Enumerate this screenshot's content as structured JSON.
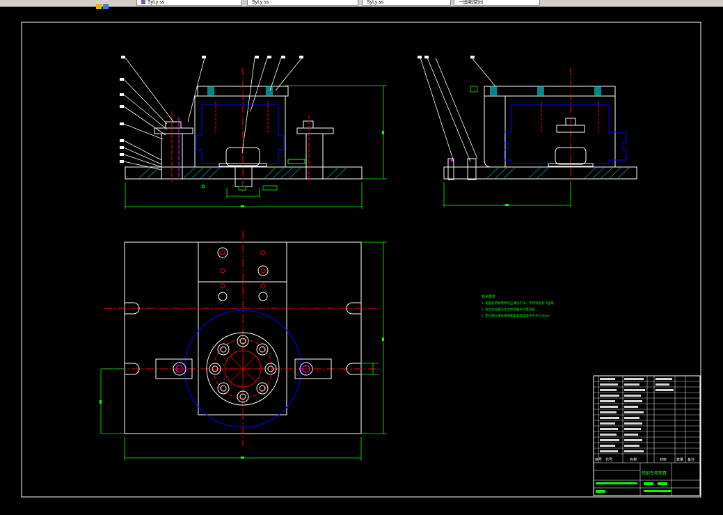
{
  "window": {
    "tabs": [
      {
        "label": "Sy̲Ly̲ ss"
      },
      {
        "label": "Sy̲Ly̲ ss"
      },
      {
        "label": "Sy̲Ly̲ ss"
      },
      {
        "label": "一图纸空间"
      }
    ]
  },
  "drawing": {
    "notes_title": "技术要求",
    "notes": [
      "1. 装配前所有零件均应清洗干净，不得有毛刺飞边等",
      "2. 夹具定位面与夹具体底面平行度误差",
      "3. 定位销与夹具体底面垂直度误差不大于0.02mm"
    ],
    "title_block": {
      "name": "铣削专用夹具",
      "cols": [
        "序号",
        "代号",
        "名称",
        "材料",
        "数量",
        "备注"
      ]
    },
    "colors": {
      "background": "#000000",
      "outline": "#ffffff",
      "center": "#ff0000",
      "hidden": "#0000ff",
      "hatch": "#00c0c0",
      "green": "#00ff00",
      "magenta": "#ff00ff",
      "yellow": "#ffff00"
    }
  }
}
